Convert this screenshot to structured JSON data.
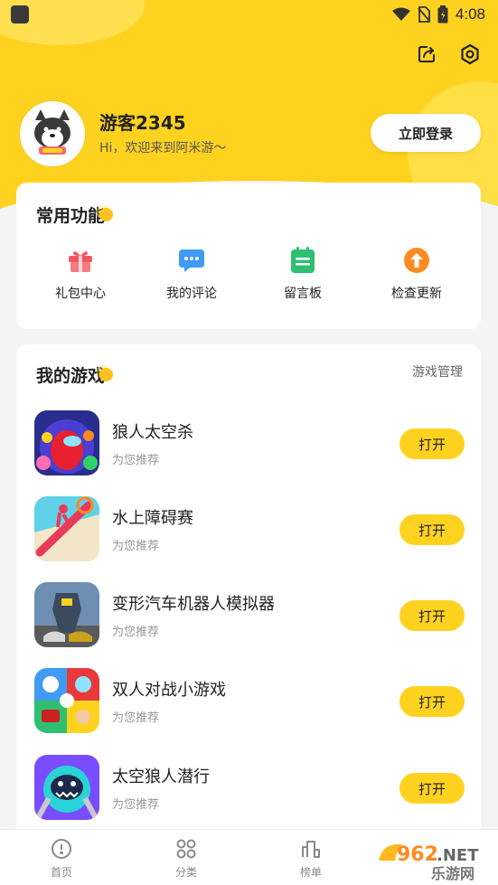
{
  "status_bar": {
    "time": "4:08"
  },
  "profile": {
    "username": "游客2345",
    "welcome": "Hi，欢迎来到阿米游～",
    "login_label": "立即登录"
  },
  "functions": {
    "title": "常用功能",
    "items": [
      {
        "label": "礼包中心",
        "icon": "gift-icon",
        "color": "#f4555f"
      },
      {
        "label": "我的评论",
        "icon": "comment-icon",
        "color": "#3f9bf5"
      },
      {
        "label": "留言板",
        "icon": "message-board-icon",
        "color": "#2fbf71"
      },
      {
        "label": "检查更新",
        "icon": "update-icon",
        "color": "#ff8a1f"
      }
    ]
  },
  "my_games": {
    "title": "我的游戏",
    "manage_label": "游戏管理",
    "open_label": "打开",
    "items": [
      {
        "name": "狼人太空杀",
        "sub": "为您推荐"
      },
      {
        "name": "水上障碍赛",
        "sub": "为您推荐"
      },
      {
        "name": "变形汽车机器人模拟器",
        "sub": "为您推荐"
      },
      {
        "name": "双人对战小游戏",
        "sub": "为您推荐"
      },
      {
        "name": "太空狼人潜行",
        "sub": "为您推荐"
      }
    ]
  },
  "bottom_nav": [
    {
      "label": "首页"
    },
    {
      "label": "分类"
    },
    {
      "label": "榜单"
    }
  ],
  "watermark": {
    "text1": "962",
    "text2": ".NET",
    "text3": "乐游网"
  },
  "colors": {
    "accent": "#ffd21f",
    "background": "#f4f4f4"
  }
}
